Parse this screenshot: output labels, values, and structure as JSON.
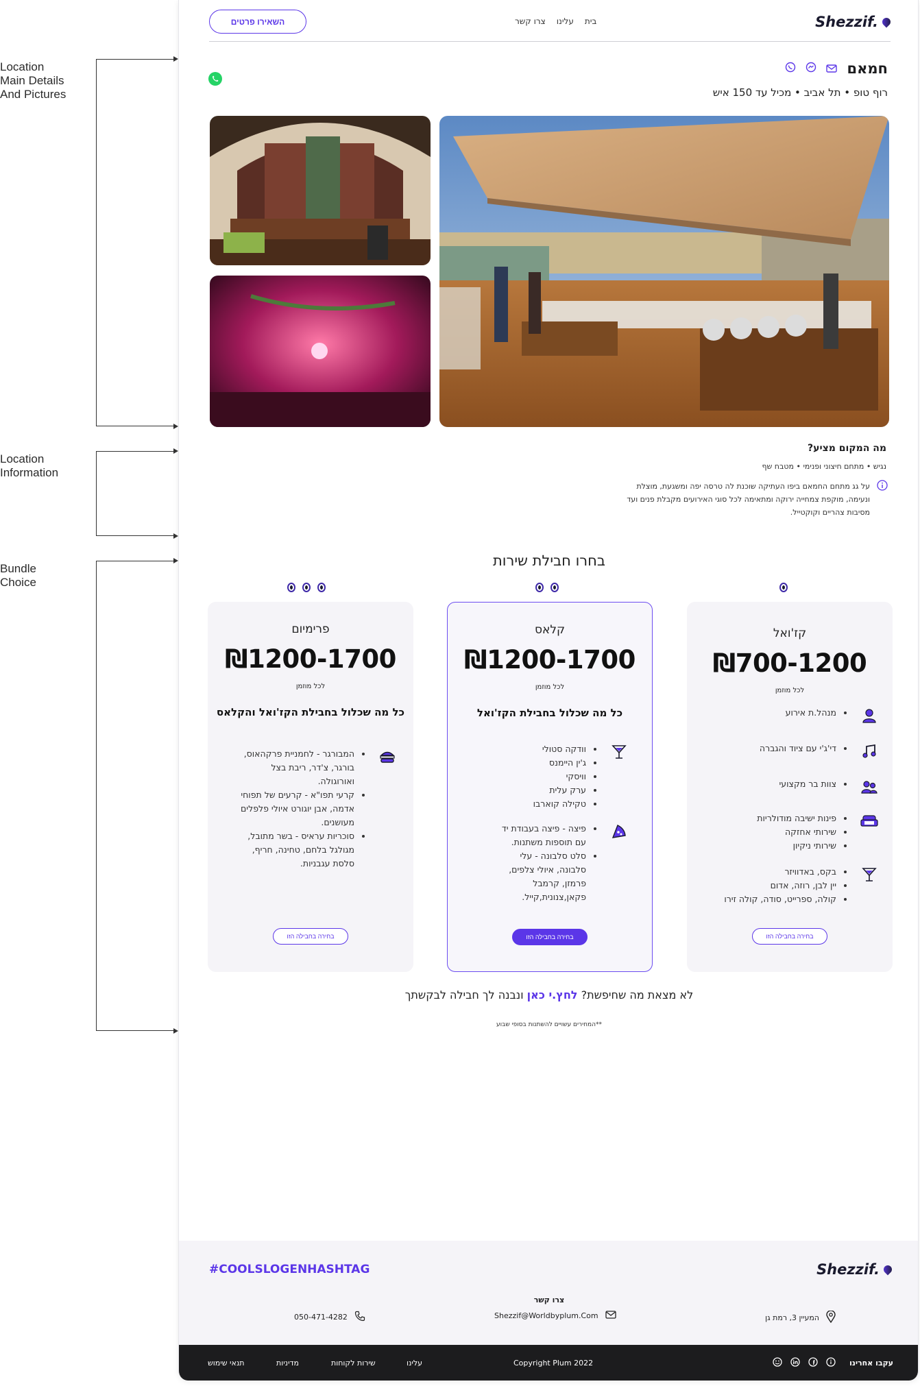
{
  "annotations": [
    {
      "label": "Location\nMain Details\nAnd Pictures"
    },
    {
      "label": "Location\nInformation"
    },
    {
      "label": "Bundle\nChoice"
    }
  ],
  "header": {
    "logo": "Shezzif.",
    "nav": [
      "בית",
      "עלינו",
      "צרו קשר"
    ],
    "cta": "השאירו פרטים"
  },
  "venue": {
    "name": "חמאם",
    "subtitle": "רוף טופ • תל אביב • מכיל עד 150 איש",
    "share_icons": [
      "whatsapp-icon",
      "messenger-icon",
      "mail-icon"
    ],
    "whatsapp_float": "whatsapp-icon"
  },
  "offer": {
    "title": "מה המקום מציע?",
    "tags": "נגיש • מתחם חיצוני ופנימי • מטבח שף",
    "description": "על גג  מתחם החמאם ביפו העתיקה שוכנת לה טרסה יפה ומשגעת, מוצלת ונעימה, מוקפת צמחייה ירוקה ומתאימה לכל סוגי האירועים מקבלת פנים ועד מסיבות צהריים וקוקטייל."
  },
  "bundles": {
    "heading": "בחרו חבילת שירות",
    "cards": [
      {
        "title": "קז'ואל",
        "price": "₪700-1200",
        "per": "לכל מוזמן",
        "groups": [
          {
            "icon": "person-icon",
            "items": [
              "מנהל.ת אירוע"
            ]
          },
          {
            "icon": "music-note-icon",
            "items": [
              "די'ג'י עם ציוד והגברה"
            ]
          },
          {
            "icon": "team-icon",
            "items": [
              "צוות בר מקצועי"
            ]
          },
          {
            "icon": "sofa-icon",
            "items": [
              "פינות ישיבה מודולריות",
              "שירותי אחזקה",
              "שירותי ניקיון"
            ]
          },
          {
            "icon": "cocktail-icon",
            "items": [
              "בקס, באדוויזר",
              "יין לבן, רוזה, אדום",
              "קולה, ספרייט, סודה, קולה זירו"
            ]
          }
        ],
        "button": "בחירה בחבילה הזו"
      },
      {
        "title": "קלאס",
        "price": "₪1200-1700",
        "per": "לכל מוזמן",
        "includes": "כל מה שכלול בחבילת הקז'ואל",
        "groups": [
          {
            "icon": "cocktail-icon",
            "items": [
              "וודקה סטולי",
              "ג'ין היימנס",
              "וויסקי",
              "ערק עלית",
              "טקילה קוארבו"
            ]
          },
          {
            "icon": "pizza-icon",
            "items": [
              "פיצה - פיצה בעבודת יד עם תוספות משתנות.",
              "סלט סלבונה - עלי סלבונה, איולי צלפים, פרמזן, קרמבל פקאן,צנונית,קייל."
            ]
          }
        ],
        "button": "בחירה בחבילה הזו"
      },
      {
        "title": "פרימיום",
        "price": "₪1200-1700",
        "per": "לכל מוזמן",
        "includes": "כל מה שכלול בחבילת הקז'ואל והקלאס",
        "groups": [
          {
            "icon": "burger-icon",
            "items": [
              "המבורגר - לחמניית פרקהאוס, בורגר, צ'דר, ריבת בצל ואורוגולה.",
              "קרעי תפו\"א - קרעים של תפוחי אדמה, אבן יוגורט איולי פלפלים מעושנים.",
              "סוכריות עראיס - בשר מתובל, מגולגל בלחם, טחינה, חריף, סלסת עגבניות."
            ]
          }
        ],
        "button": "בחירה בחבילה הזו"
      }
    ],
    "not_found": {
      "before": "לא מצאת מה שחיפשת?",
      "link": "לחץ.י כאן",
      "after": "ונבנה לך חבילה לבקשתך"
    },
    "disclaimer": "**המחירים עשויים להשתנות בסופי שבוע"
  },
  "footer": {
    "logo": "Shezzif.",
    "hashtag": "#COOLSLOGENHASHTAG",
    "contact_title": "צרו קשר",
    "address": "המעיין 3, רמת גן",
    "email": "Shezzif@Worldbyplum.Com",
    "phone": "050-471-4282",
    "follow": "עקבו אחרינו",
    "copyright": "Copyright Plum 2022",
    "links": [
      "עלינו",
      "שירות לקוחות",
      "מדיניות",
      "תנאי שימוש"
    ]
  },
  "colors": {
    "accent": "#5b36e8",
    "dark": "#1c1c1e",
    "card": "#f5f4f8",
    "whatsapp": "#25d366"
  }
}
